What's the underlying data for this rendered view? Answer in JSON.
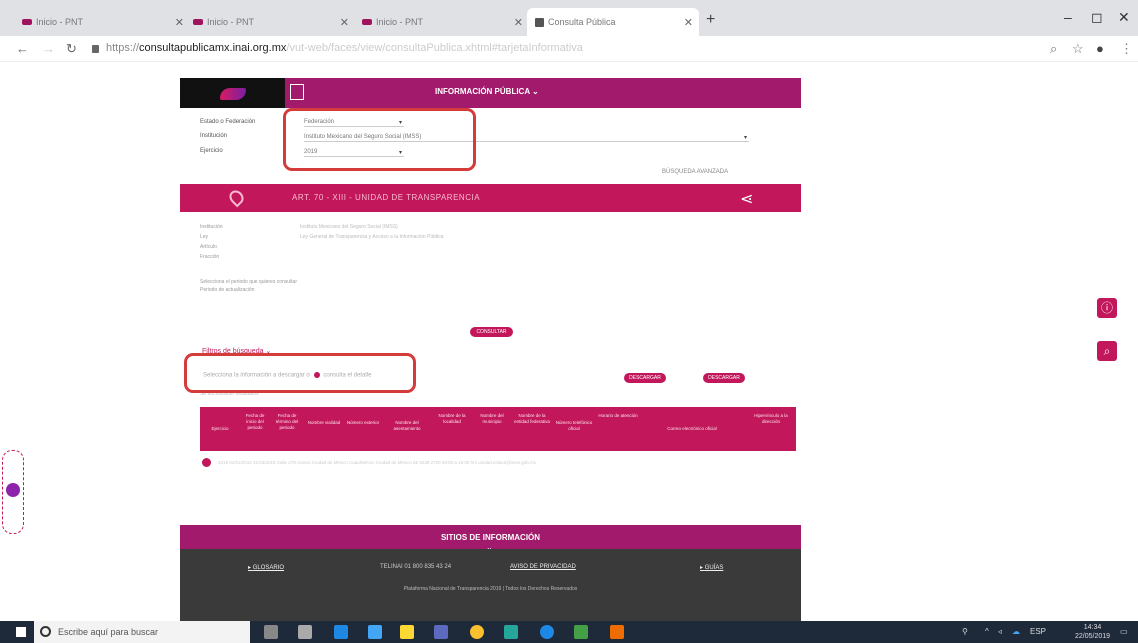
{
  "browser": {
    "tabs": [
      {
        "title": "Inicio - PNT",
        "icon": "pnt-favicon"
      },
      {
        "title": "Inicio - PNT",
        "icon": "pnt-favicon"
      },
      {
        "title": "Inicio - PNT",
        "icon": "pnt-favicon"
      },
      {
        "title": "Consulta Pública",
        "icon": "document-favicon"
      }
    ],
    "url_prefix": "https://",
    "url_host": "consultapublicamx.inai.org.mx",
    "url_path": "/vut-web/faces/view/consultaPublica.xhtml#tarjetaInformativa"
  },
  "page": {
    "header_title": "INFORMACIÓN PÚBLICA ⌄",
    "filters": {
      "estado_label": "Estado o Federación",
      "estado_value": "Federación",
      "institucion_label": "Institución",
      "institucion_value": "Instituto Mexicano del Seguro Social (IMSS)",
      "ejercicio_label": "Ejercicio",
      "ejercicio_value": "2019",
      "advanced_search": "BÚSQUEDA AVANZADA"
    },
    "article_title": "ART. 70 - XIII - UNIDAD DE TRANSPARENCIA",
    "info_labels": [
      "Institución",
      "Ley",
      "Artículo",
      "Fracción"
    ],
    "info_values": [
      "Instituto Mexicano del Seguro Social (IMSS)",
      "Ley General de Transparencia y Acceso a la Información Pública",
      "",
      ""
    ],
    "periodo_label": "Periodo de actualización",
    "periodo_prefix": "Selecciona el periodo que quieres consultar",
    "consult_button": "CONSULTAR",
    "filtros_link": "Filtros de búsqueda ⌄",
    "selection_text": "Selecciona la información a descargar o ",
    "selection_link": "consulta el detalle",
    "download_button": "DESCARGAR",
    "download_all_button": "DESCARGAR",
    "results_label": "Se encontraron resultados",
    "table_headers": [
      "Ejercicio",
      "Fecha de inicio del periodo",
      "Fecha de término del periodo",
      "Nombre vialidad",
      "Número exterior",
      "Nombre del asentamiento",
      "Nombre de la localidad",
      "Nombre del municipio",
      "Nombre de la entidad federativa",
      "Número telefónico oficial",
      "Horario de atención",
      "Correo electrónico oficial",
      "Hipervínculo a la dirección"
    ],
    "table_row": "2019  01/01/2019  31/03/2019  Calle  479  Centro  Ciudad de México  Cuauhtémoc  Ciudad de México  55 5238 2700  09:00 a 15:00 hrs  unidad.enlace@imss.gob.mx",
    "footer_title": "SITIOS DE INFORMACIÓN",
    "footer_links": {
      "glosario": "GLOSARIO",
      "telinai": "TELINAI 01 800 835 43 24",
      "aviso": "AVISO DE PRIVACIDAD",
      "guias": "GUÍAS"
    },
    "copyright": "Plataforma Nacional de Transparencia 2019 | Todos los Derechos Reservados"
  },
  "taskbar": {
    "search_placeholder": "Escribe aquí para buscar",
    "lang": "ESP",
    "time": "14:34",
    "date": "22/05/2019"
  },
  "colors": {
    "brand": "#a21a6b",
    "accent": "#c2185b",
    "highlight_box": "#d43b3b"
  }
}
